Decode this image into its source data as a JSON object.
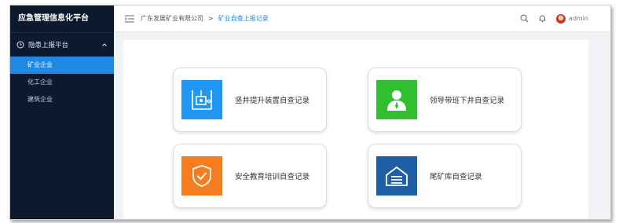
{
  "app": {
    "title": "应急管理信息化平台"
  },
  "sidebar": {
    "group": {
      "label": "隐患上报平台"
    },
    "items": [
      {
        "label": "矿业企业"
      },
      {
        "label": "化工企业"
      },
      {
        "label": "建筑企业"
      }
    ]
  },
  "header": {
    "breadcrumb": [
      "广东发展矿业有限公司",
      "矿业自查上报记录"
    ],
    "breadcrumb_separator": ">",
    "user": {
      "name": "admin"
    }
  },
  "cards": [
    {
      "title": "竖井提升装置自查记录",
      "icon": "elevator-icon",
      "color": "#2196f3"
    },
    {
      "title": "领导带班下井自查记录",
      "icon": "leader-person-icon",
      "color": "#2fbf2f"
    },
    {
      "title": "安全教育培训自查记录",
      "icon": "shield-check-icon",
      "color": "#f57c1f"
    },
    {
      "title": "尾矿库自查记录",
      "icon": "tailings-storage-icon",
      "color": "#1f5fa8"
    }
  ],
  "colors": {
    "sidebar_bg": "#0b1a2e",
    "accent": "#1e88e5"
  }
}
